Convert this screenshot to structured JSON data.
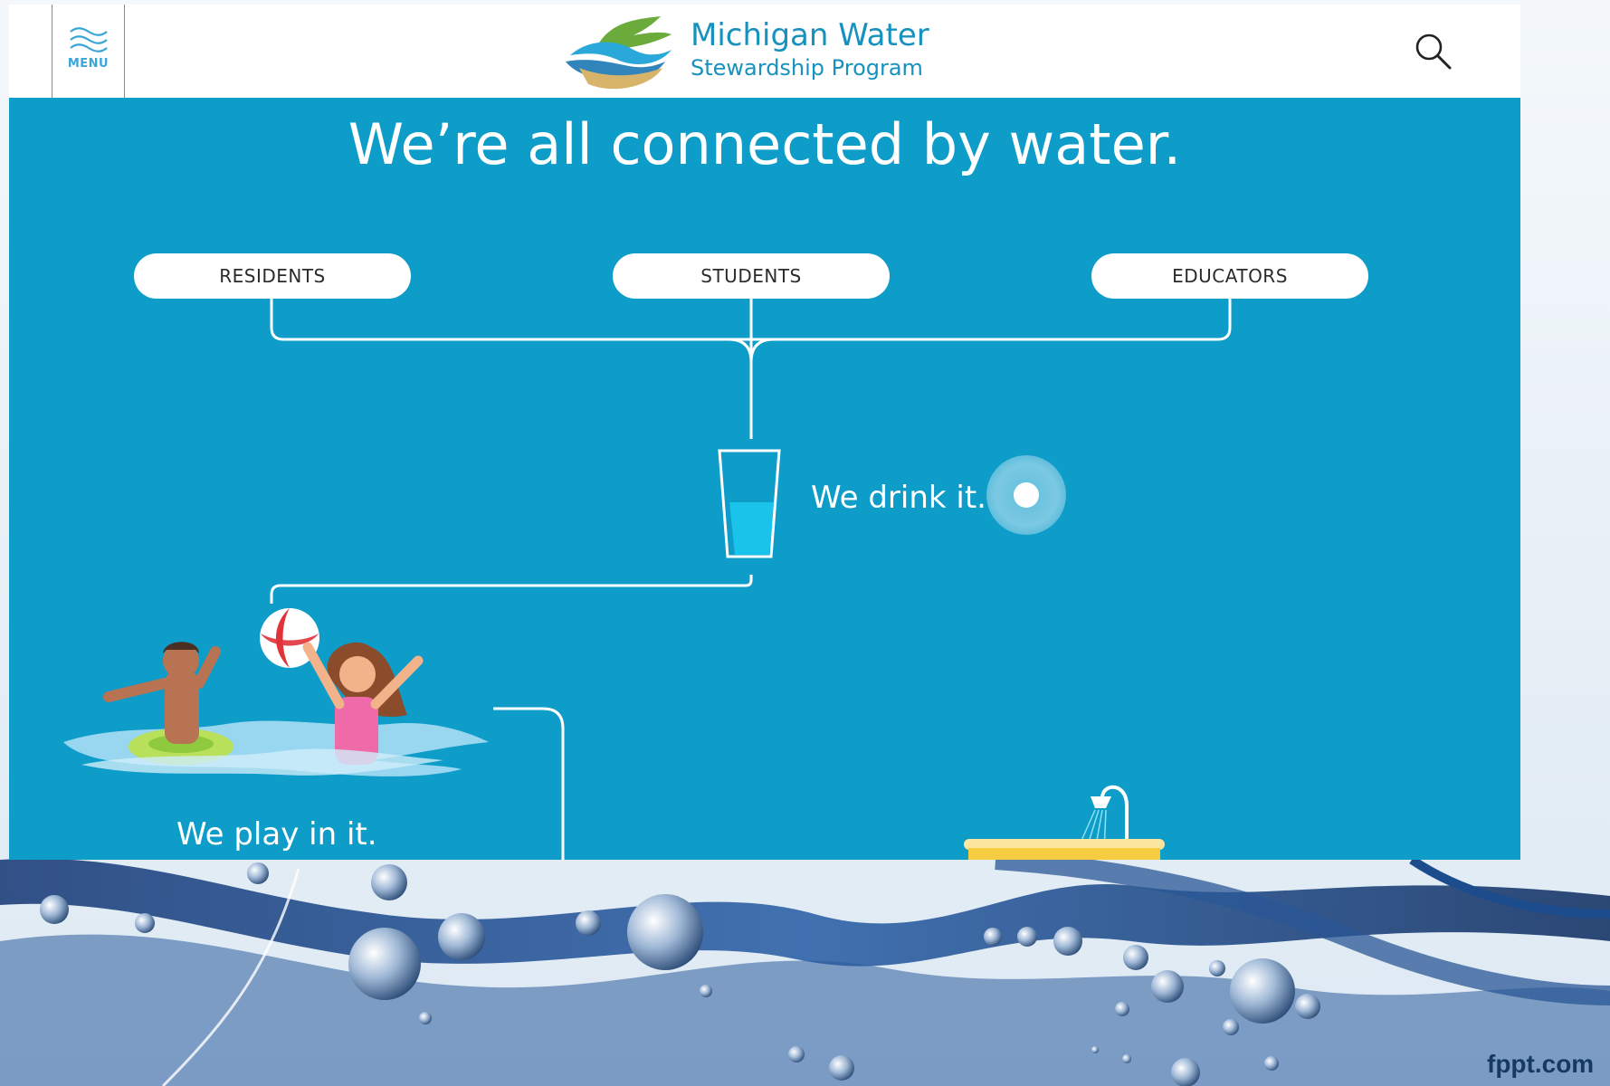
{
  "header": {
    "menu_label": "MENU",
    "brand_line1": "Michigan Water",
    "brand_line2": "Stewardship Program",
    "icons": {
      "menu": "waves-menu-icon",
      "search": "search-icon",
      "logo": "hands-water-logo"
    }
  },
  "hero": {
    "heading": "We’re all connected by water."
  },
  "audiences": [
    "RESIDENTS",
    "STUDENTS",
    "EDUCATORS"
  ],
  "story": {
    "drink_text": "We drink it.",
    "play_text": "We play in it."
  },
  "slide": {
    "watermark": "fppt.com"
  },
  "colors": {
    "site_blue": "#0e9cc9",
    "brand_blue": "#1792be",
    "white": "#ffffff"
  }
}
